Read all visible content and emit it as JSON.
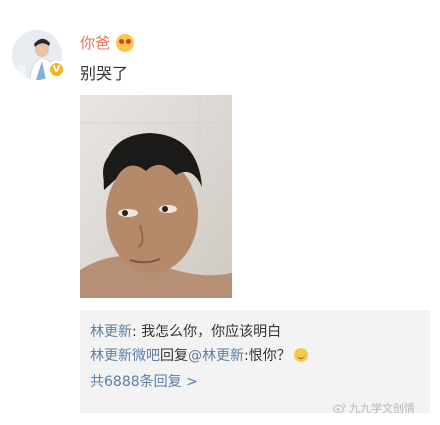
{
  "post": {
    "username": "你爸",
    "username_emoji": "shocked-face-emoji",
    "text": "别哭了",
    "avatar_badge": "V"
  },
  "comments": [
    {
      "user": "林更新",
      "separator": ":",
      "text": " 我怎么你，你应该明白"
    },
    {
      "user": "林更新微吧",
      "reply_word": "回复",
      "reply_to": "@林更新",
      "separator": ":",
      "text": "恨你？"
    }
  ],
  "more_replies": "共6888条回复 >",
  "watermark": "九九学文创情"
}
